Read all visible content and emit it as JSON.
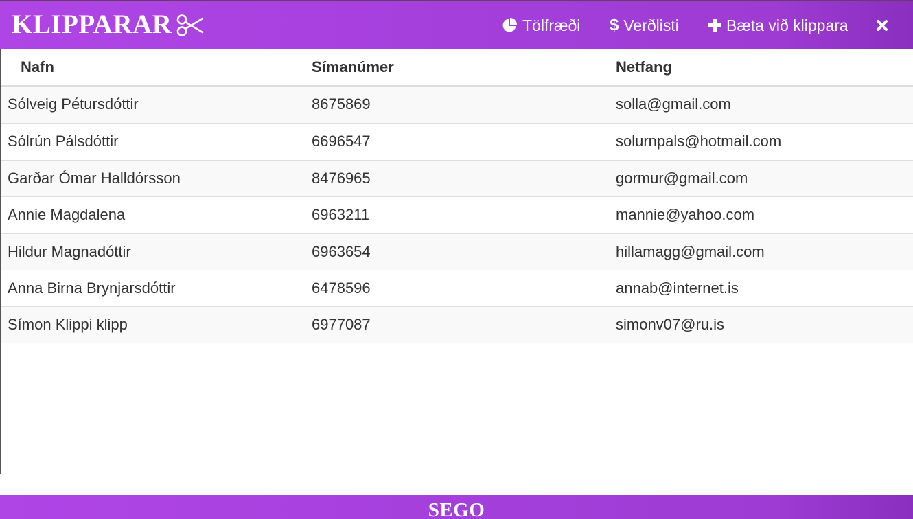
{
  "app": {
    "title": "KLIPPARAR",
    "brand_icon": "scissors-icon",
    "accent_color": "#a43fdc",
    "footer": "SEGO"
  },
  "nav": {
    "stats": {
      "label": "Tölfræði",
      "icon": "pie-chart-icon"
    },
    "price": {
      "label": "Verðlisti",
      "icon": "dollar-icon"
    },
    "add": {
      "label": "Bæta við klippara",
      "icon": "plus-icon"
    },
    "close": {
      "icon": "close-icon"
    }
  },
  "table": {
    "columns": [
      "Nafn",
      "Símanúmer",
      "Netfang"
    ],
    "rows": [
      {
        "name": "Sólveig Pétursdóttir",
        "phone": "8675869",
        "email": "solla@gmail.com"
      },
      {
        "name": "Sólrún Pálsdóttir",
        "phone": "6696547",
        "email": "solurnpals@hotmail.com"
      },
      {
        "name": "Garðar Ómar Halldórsson",
        "phone": "8476965",
        "email": "gormur@gmail.com"
      },
      {
        "name": "Annie Magdalena",
        "phone": "6963211",
        "email": "mannie@yahoo.com"
      },
      {
        "name": "Hildur Magnadóttir",
        "phone": "6963654",
        "email": "hillamagg@gmail.com"
      },
      {
        "name": "Anna Birna Brynjarsdóttir",
        "phone": "6478596",
        "email": "annab@internet.is"
      },
      {
        "name": "Símon Klippi klipp",
        "phone": "6977087",
        "email": "simonv07@ru.is"
      }
    ]
  }
}
